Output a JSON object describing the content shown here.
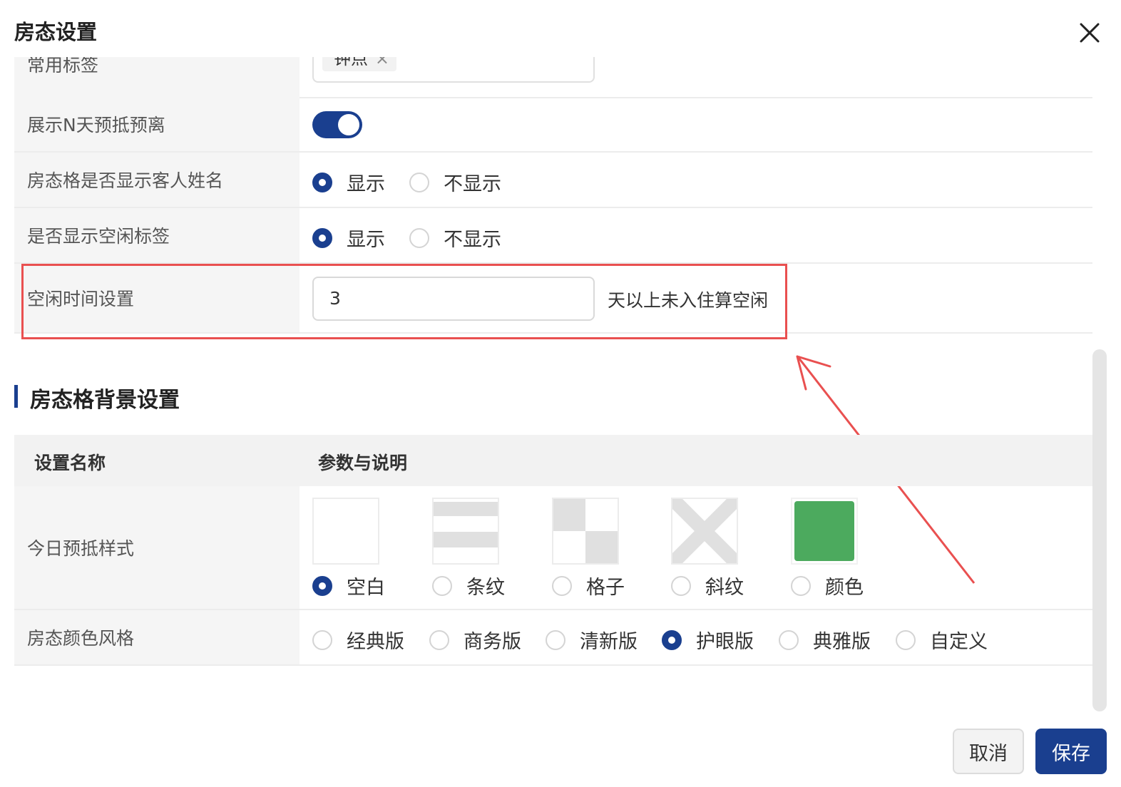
{
  "dialog": {
    "title": "房态设置"
  },
  "rows": {
    "tags": {
      "label": "常用标签",
      "tag_value": "钟点",
      "tag_close": "×"
    },
    "preview_days": {
      "label": "展示N天预抵预离",
      "enabled": true
    },
    "guest_name": {
      "label": "房态格是否显示客人姓名",
      "option_show": "显示",
      "option_hide": "不显示",
      "selected": "显示"
    },
    "idle_tag": {
      "label": "是否显示空闲标签",
      "option_show": "显示",
      "option_hide": "不显示",
      "selected": "显示"
    },
    "idle_time": {
      "label": "空闲时间设置",
      "value": "3",
      "suffix": "天以上未入住算空闲"
    }
  },
  "background_section": {
    "title": "房态格背景设置",
    "headers": {
      "name": "设置名称",
      "desc": "参数与说明"
    },
    "style_row": {
      "label": "今日预抵样式",
      "options": [
        "空白",
        "条纹",
        "格子",
        "斜纹",
        "颜色"
      ],
      "selected": "空白",
      "color_swatch": "#4caa5e"
    },
    "color_row": {
      "label": "房态颜色风格",
      "options": [
        "经典版",
        "商务版",
        "清新版",
        "护眼版",
        "典雅版",
        "自定义"
      ],
      "selected": "护眼版"
    }
  },
  "footer": {
    "cancel": "取消",
    "save": "保存"
  },
  "colors": {
    "primary": "#1a3f8f",
    "highlight_box": "#e95050",
    "label_bg": "#f5f5f5"
  }
}
